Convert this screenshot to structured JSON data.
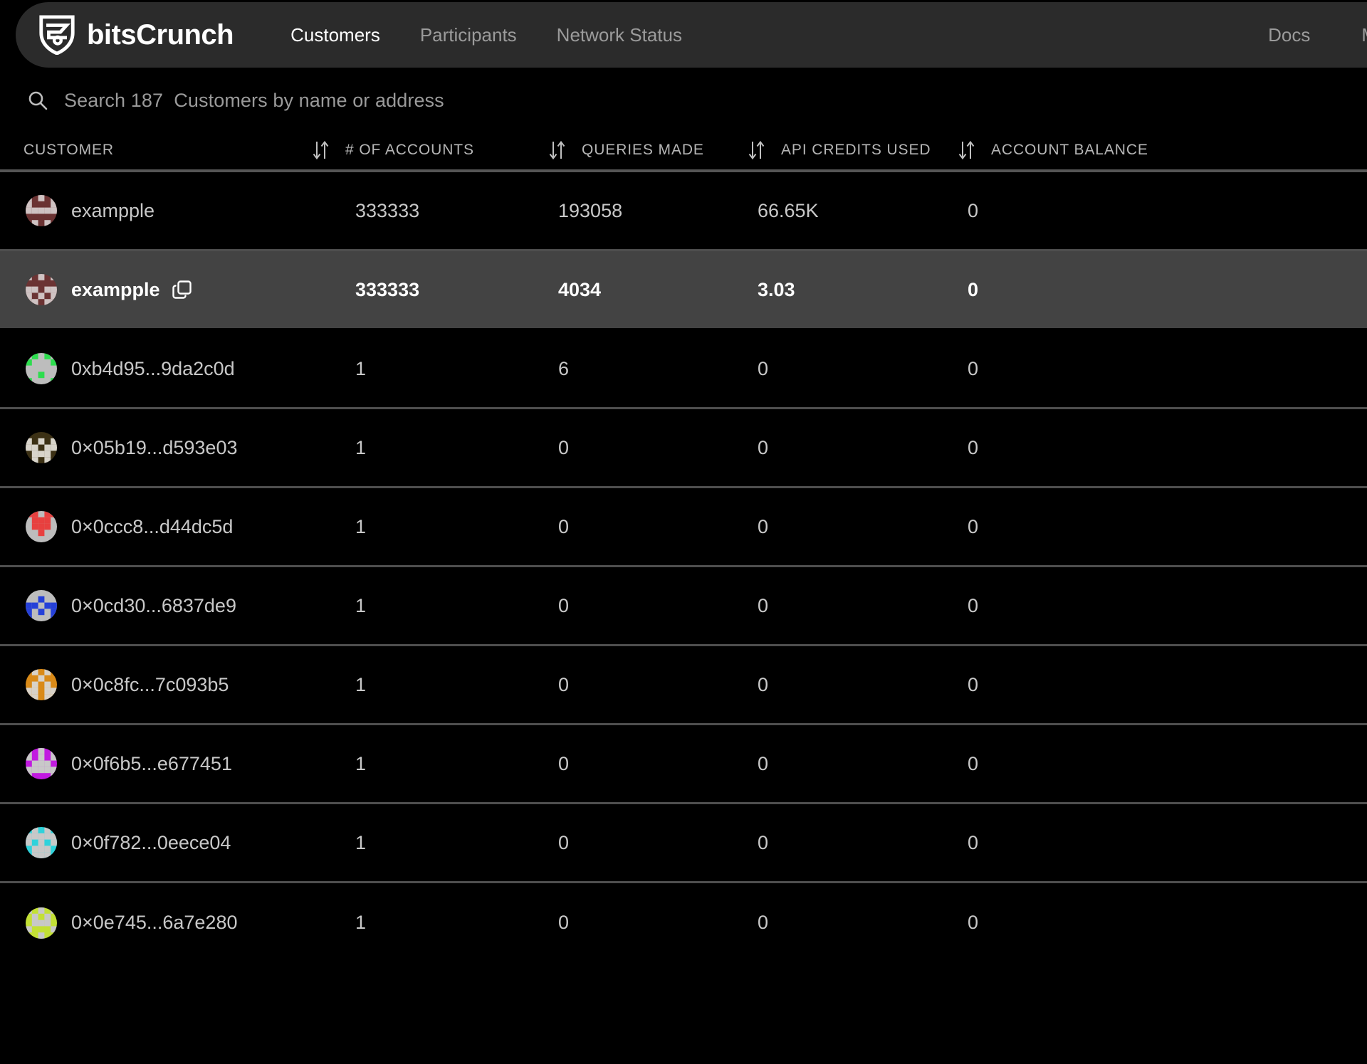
{
  "header": {
    "brand": "bitsCrunch",
    "logo_icon": "shield-logo-icon",
    "nav_left": [
      {
        "label": "Customers",
        "active": true
      },
      {
        "label": "Participants",
        "active": false
      },
      {
        "label": "Network Status",
        "active": false
      }
    ],
    "nav_right": [
      {
        "label": "Docs",
        "active": false
      },
      {
        "label": "M",
        "active": false
      }
    ],
    "bar_color": "#2b2b2b"
  },
  "search": {
    "icon": "search-icon",
    "placeholder": "Search 187  Customers by name or address",
    "value": "",
    "count": "187"
  },
  "table": {
    "columns": [
      {
        "label": "CUSTOMER",
        "sortable": true
      },
      {
        "label": "# OF ACCOUNTS",
        "sortable": true
      },
      {
        "label": "QUERIES MADE",
        "sortable": true
      },
      {
        "label": "API CREDITS USED",
        "sortable": true
      },
      {
        "label": "ACCOUNT BALANCE",
        "sortable": false
      }
    ],
    "sort_icon": "sort-updown-icon",
    "rows": [
      {
        "customer": "exampple",
        "accounts": "333333",
        "queries": "193058",
        "credits": "66.65K",
        "balance": "0",
        "avatar_color": "#6b3333",
        "avatar_fg": "#cfc3c3",
        "highlighted": false,
        "copy": false
      },
      {
        "customer": "exampple",
        "accounts": "333333",
        "queries": "4034",
        "credits": "3.03",
        "balance": "0",
        "avatar_color": "#6b3333",
        "avatar_fg": "#cfc3c3",
        "highlighted": true,
        "copy": true,
        "copy_icon": "copy-icon"
      },
      {
        "customer": "0xb4d95...9da2c0d",
        "accounts": "1",
        "queries": "6",
        "credits": "0",
        "balance": "0",
        "avatar_color": "#bdbdbd",
        "avatar_fg": "#2ddd4e",
        "highlighted": false,
        "copy": false
      },
      {
        "customer": "0×05b19...d593e03",
        "accounts": "1",
        "queries": "0",
        "credits": "0",
        "balance": "0",
        "avatar_color": "#3c3115",
        "avatar_fg": "#d8d4cb",
        "highlighted": false,
        "copy": false
      },
      {
        "customer": "0×0ccc8...d44dc5d",
        "accounts": "1",
        "queries": "0",
        "credits": "0",
        "balance": "0",
        "avatar_color": "#bdbdbd",
        "avatar_fg": "#e8403f",
        "highlighted": false,
        "copy": false
      },
      {
        "customer": "0×0cd30...6837de9",
        "accounts": "1",
        "queries": "0",
        "credits": "0",
        "balance": "0",
        "avatar_color": "#bdbdbd",
        "avatar_fg": "#2540d8",
        "highlighted": false,
        "copy": false
      },
      {
        "customer": "0×0c8fc...7c093b5",
        "accounts": "1",
        "queries": "0",
        "credits": "0",
        "balance": "0",
        "avatar_color": "#d98a18",
        "avatar_fg": "#d8d2c8",
        "highlighted": false,
        "copy": false
      },
      {
        "customer": "0×0f6b5...e677451",
        "accounts": "1",
        "queries": "0",
        "credits": "0",
        "balance": "0",
        "avatar_color": "#c11ae0",
        "avatar_fg": "#c8c8c8",
        "highlighted": false,
        "copy": false
      },
      {
        "customer": "0×0f782...0eece04",
        "accounts": "1",
        "queries": "0",
        "credits": "0",
        "balance": "0",
        "avatar_color": "#2fd2db",
        "avatar_fg": "#c8c8c8",
        "highlighted": false,
        "copy": false
      },
      {
        "customer": "0×0e745...6a7e280",
        "accounts": "1",
        "queries": "0",
        "credits": "0",
        "balance": "0",
        "avatar_color": "#c3e035",
        "avatar_fg": "#c8c8c8",
        "highlighted": false,
        "copy": false
      }
    ]
  },
  "colors": {
    "background": "#000000",
    "nav_bg": "#2b2b2b",
    "row_highlight": "#434343",
    "divider": "#4e4e4e",
    "text_primary": "#c8c8c8",
    "text_muted": "#9b9b9b",
    "text_active": "#ffffff"
  }
}
